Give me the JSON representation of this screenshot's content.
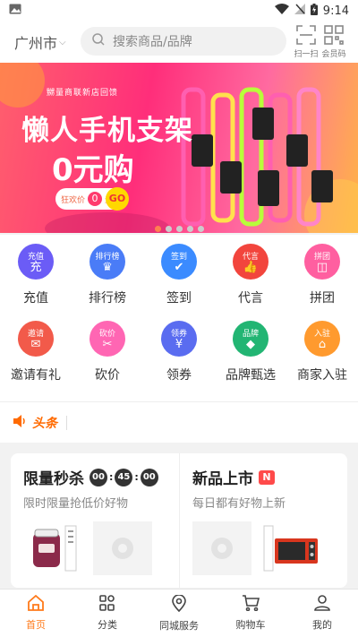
{
  "status": {
    "time": "9:14"
  },
  "header": {
    "city": "广州市",
    "search_placeholder": "搜索商品/品牌",
    "scan_label": "扫一扫",
    "member_label": "会员码"
  },
  "banner": {
    "subtitle": "嬲量商联新店回馈",
    "title_line1": "懒人手机支架",
    "title_line2": "0元购",
    "pill_prefix": "狂欢价",
    "pill_zero": "0",
    "pill_unit": "元",
    "pill_go": "GO",
    "slides": 5,
    "active_slide": 0
  },
  "menu": {
    "row1": [
      {
        "icon_text": "充值",
        "glyph": "充",
        "label": "充值",
        "color": "#6b5cf6"
      },
      {
        "icon_text": "排行榜",
        "glyph": "♛",
        "label": "排行榜",
        "color": "#4a7cf7"
      },
      {
        "icon_text": "签到",
        "glyph": "✔",
        "label": "签到",
        "color": "#3b8bff"
      },
      {
        "icon_text": "代言",
        "glyph": "👍",
        "label": "代言",
        "color": "#f2453d"
      },
      {
        "icon_text": "拼团",
        "glyph": "◫",
        "label": "拼团",
        "color": "#ff5fa0"
      }
    ],
    "row2": [
      {
        "icon_text": "邀请",
        "glyph": "✉",
        "label": "邀请有礼",
        "color": "#f25a4a"
      },
      {
        "icon_text": "砍价",
        "glyph": "✂",
        "label": "砍价",
        "color": "#ff66b3"
      },
      {
        "icon_text": "领券",
        "glyph": "¥",
        "label": "领券",
        "color": "#5a6cf0"
      },
      {
        "icon_text": "品牌",
        "glyph": "◆",
        "label": "品牌甄选",
        "color": "#22b573"
      },
      {
        "icon_text": "入驻",
        "glyph": "⌂",
        "label": "商家入驻",
        "color": "#ff9a2e"
      }
    ]
  },
  "news": {
    "title": "头条"
  },
  "flash": {
    "title": "限量秒杀",
    "hours": "00",
    "minutes": "45",
    "seconds": "00",
    "subtitle": "限时限量抢低价好物"
  },
  "new_arrivals": {
    "title": "新品上市",
    "badge": "N",
    "subtitle": "每日都有好物上新"
  },
  "tabbar": [
    {
      "label": "首页",
      "icon": "home-icon",
      "active": true
    },
    {
      "label": "分类",
      "icon": "category-icon",
      "active": false
    },
    {
      "label": "同城服务",
      "icon": "location-icon",
      "active": false
    },
    {
      "label": "购物车",
      "icon": "cart-icon",
      "active": false
    },
    {
      "label": "我的",
      "icon": "user-icon",
      "active": false
    }
  ],
  "colors": {
    "accent": "#ff7a1a",
    "news": "#ff6a00"
  }
}
